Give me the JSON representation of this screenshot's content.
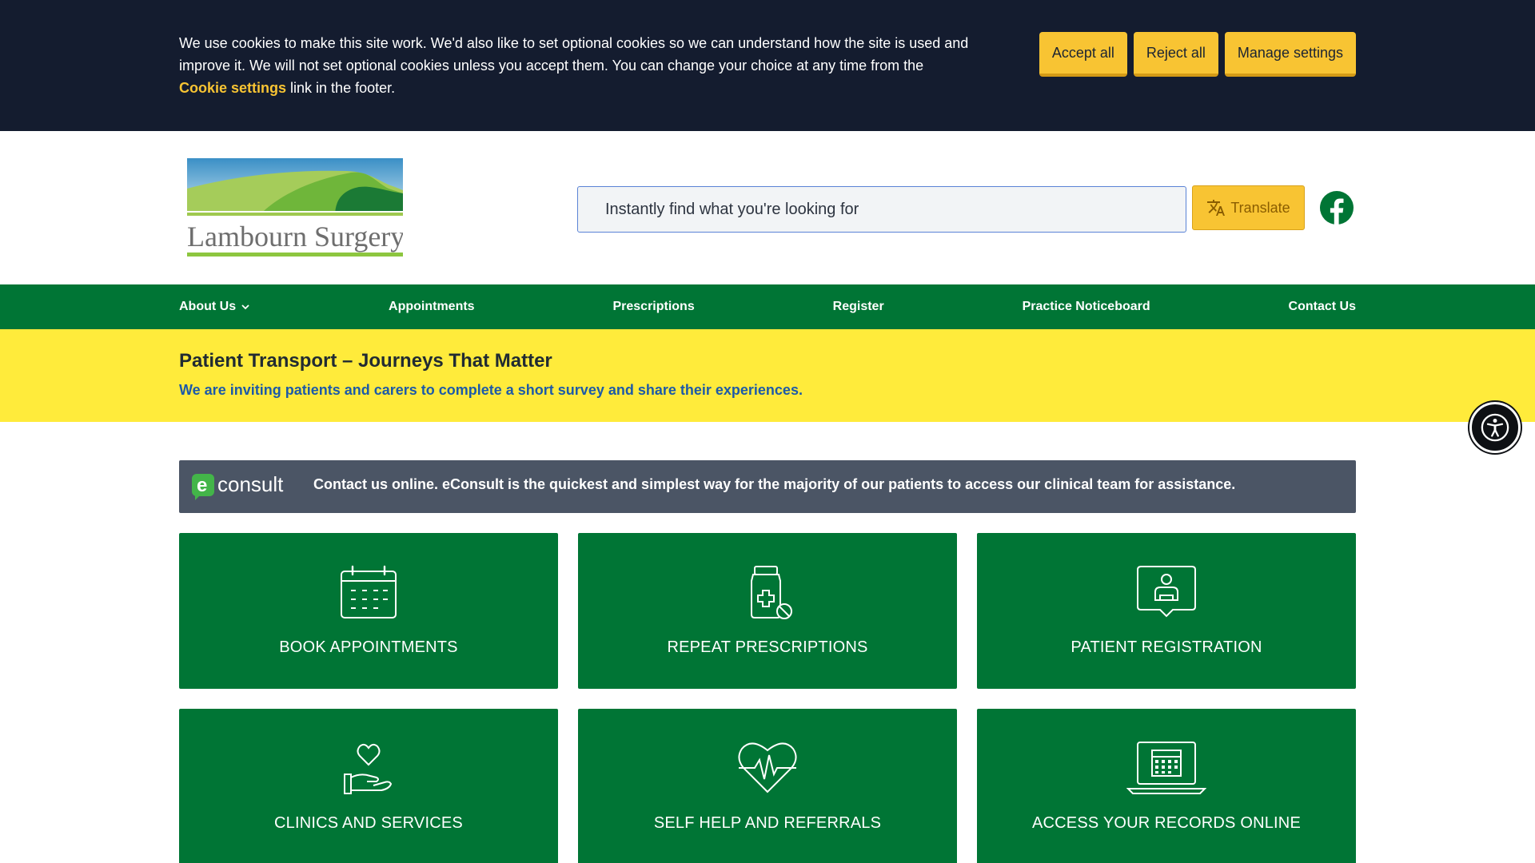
{
  "cookie_banner": {
    "text_before": "We use cookies to make this site work. We'd also like to set optional cookies so we can understand how the site is used and improve it. We will not set optional cookies unless you accept them. You can change your choice at any time from the ",
    "link": "Cookie settings",
    "text_after": " link in the footer.",
    "buttons": {
      "accept": "Accept all",
      "reject": "Reject all",
      "manage": "Manage settings"
    }
  },
  "header": {
    "logo_text": "Lambourn Surgery",
    "search_placeholder": "Instantly find what you're looking for",
    "translate_label": "Translate"
  },
  "nav": {
    "items": [
      "About Us",
      "Appointments",
      "Prescriptions",
      "Register",
      "Practice Noticeboard",
      "Contact Us"
    ]
  },
  "notice": {
    "title": "Patient Transport – Journeys That Matter",
    "subtitle": "We are inviting patients and carers to complete a short survey and share their experiences."
  },
  "econsult": {
    "logo_text": "consult",
    "message": "Contact us online. eConsult is the quickest and simplest way for the majority of our patients to access our clinical team for assistance."
  },
  "tiles": [
    {
      "label": "BOOK APPOINTMENTS",
      "icon": "calendar-icon"
    },
    {
      "label": "REPEAT PRESCRIPTIONS",
      "icon": "medicine-bottle-icon"
    },
    {
      "label": "PATIENT REGISTRATION",
      "icon": "user-card-icon"
    },
    {
      "label": "CLINICS AND SERVICES",
      "icon": "heart-in-hand-icon"
    },
    {
      "label": "SELF HELP AND REFERRALS",
      "icon": "heartbeat-icon"
    },
    {
      "label": "ACCESS YOUR RECORDS ONLINE",
      "icon": "laptop-calendar-icon"
    }
  ],
  "colors": {
    "brand_green": "#007535",
    "banner_dark": "#141c2f",
    "accent_yellow": "#f8c433",
    "notice_yellow": "#ffeb3b",
    "link_blue": "#1d5aa8"
  }
}
